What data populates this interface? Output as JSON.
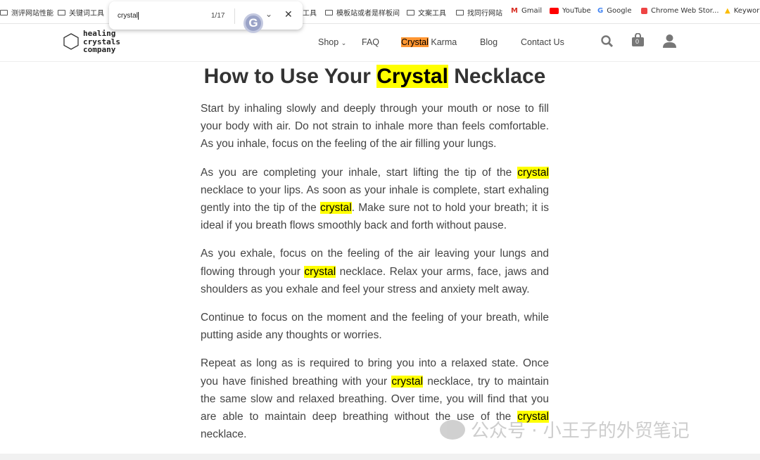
{
  "bookmarks": [
    {
      "label": "测评网站性能",
      "icon": "folder-icon"
    },
    {
      "label": "关键词工具",
      "icon": "folder-icon"
    },
    {
      "label": "工具",
      "icon": "folder-icon"
    },
    {
      "label": "模板站或者是样板间",
      "icon": "folder-icon"
    },
    {
      "label": "文案工具",
      "icon": "folder-icon"
    },
    {
      "label": "找同行网站",
      "icon": "folder-icon"
    },
    {
      "label": "Gmail",
      "icon": "gmail-icon"
    },
    {
      "label": "YouTube",
      "icon": "youtube-icon"
    },
    {
      "label": "Google",
      "icon": "google-icon"
    },
    {
      "label": "Chrome Web Stor...",
      "icon": "chrome-web-store-icon"
    },
    {
      "label": "Keywor",
      "icon": "google-ads-icon"
    }
  ],
  "find": {
    "query": "crystal",
    "count": "1/17"
  },
  "site": {
    "logo": [
      "healing",
      "crystals",
      "company"
    ],
    "nav": {
      "shop": "Shop",
      "faq": "FAQ",
      "karma_hl": "Crystal",
      "karma": " Karma",
      "blog": "Blog",
      "contact": "Contact Us"
    },
    "cart_count": "0"
  },
  "article": {
    "title": [
      "How to Use Your ",
      "Crystal",
      " Necklace"
    ],
    "p1": "Start by inhaling slowly and deeply through your mouth or nose to fill your body with air. Do not strain to inhale more than feels comfortable. As you inhale, focus on the feeling of the air filling your lungs.",
    "p2": [
      "As you are completing your inhale, start lifting the tip of the ",
      "crystal",
      " necklace to your lips. As soon as your inhale is complete, start exhaling gently into the tip of the ",
      "crystal",
      ". Make sure not to hold your breath; it is ideal if you breath flows smoothly back and forth without pause."
    ],
    "p3": [
      "As you exhale, focus on the feeling of the air leaving your lungs and flowing through your ",
      "crystal",
      " necklace. Relax your arms, face, jaws and shoulders as you exhale and feel your stress and anxiety melt away."
    ],
    "p4": "Continue to focus on the moment and the feeling of your breath, while putting aside any thoughts or worries.",
    "p5": [
      "Repeat as long as is required to bring you into a relaxed state. Once you have finished breathing with your ",
      "crystal",
      " necklace, try to maintain the same slow and relaxed breathing. Over time, you will find that you are able to maintain deep breathing without the use of the ",
      "crystal",
      " necklace."
    ]
  },
  "watermark": "公众号 · 小王子的外贸笔记",
  "colors": {
    "highlight": "#ffff00",
    "active_highlight": "#ff9632"
  }
}
